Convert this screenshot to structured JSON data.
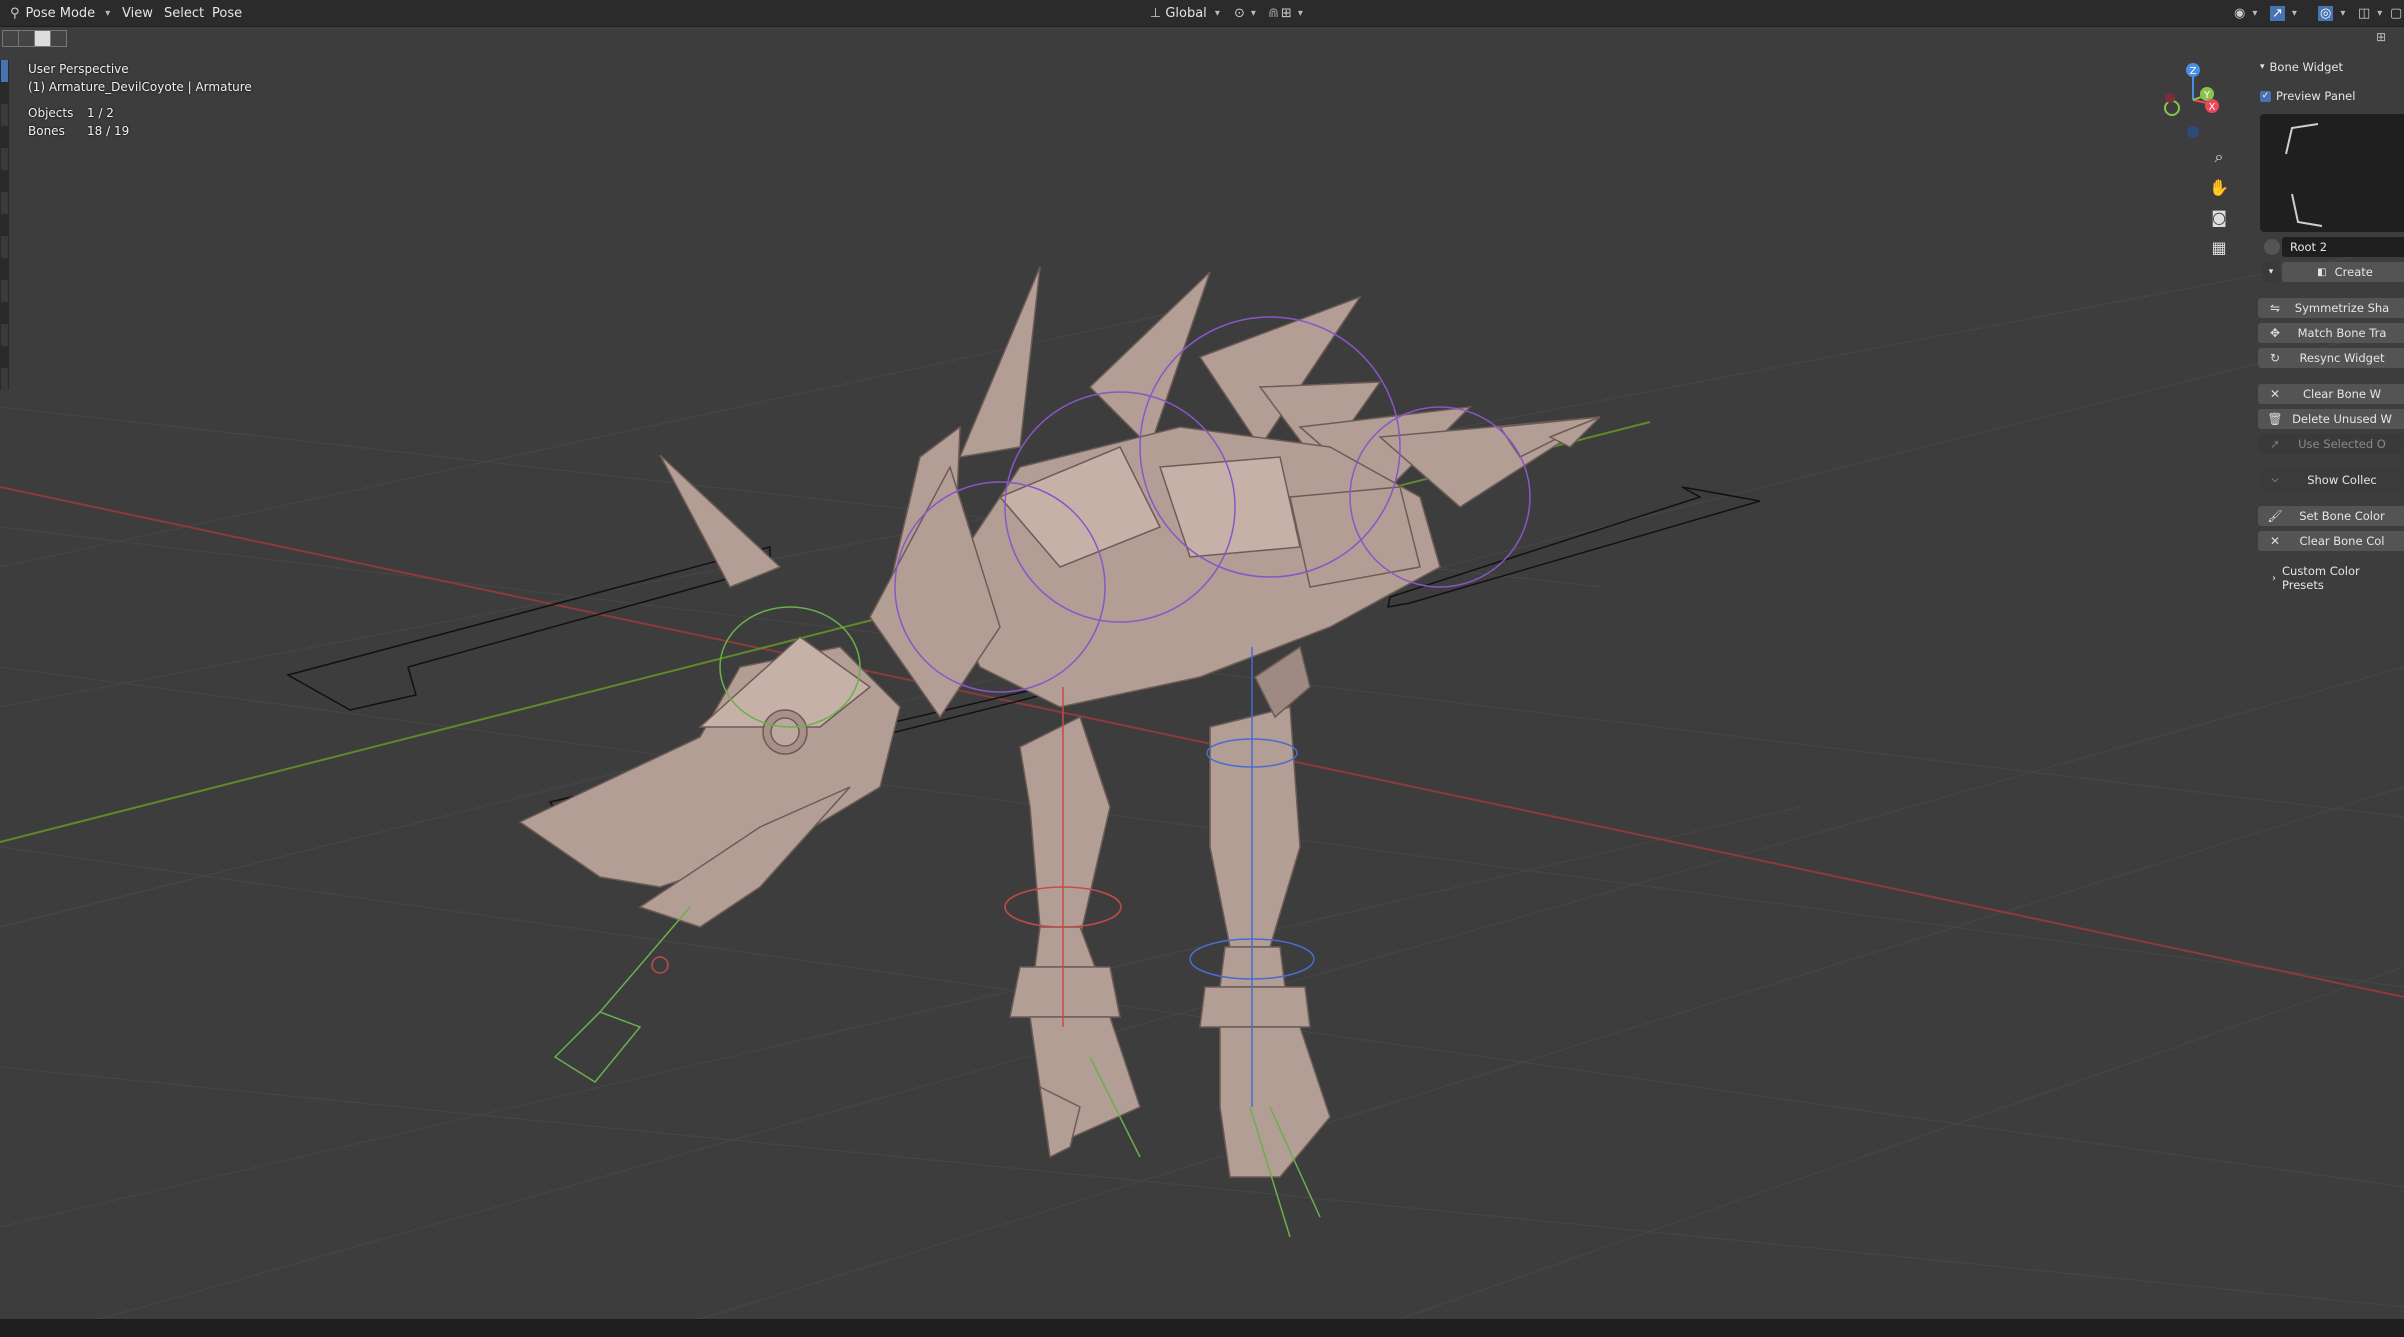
{
  "header": {
    "mode": "Pose Mode",
    "menus": [
      "View",
      "Select",
      "Pose"
    ],
    "transform_orientation": "Global"
  },
  "overlay": {
    "perspective": "User Perspective",
    "object_info": "(1) Armature_DevilCoyote | Armature",
    "stats": [
      {
        "label": "Objects",
        "value": "1 / 2"
      },
      {
        "label": "Bones",
        "value": "18 / 19"
      }
    ]
  },
  "gizmo": {
    "axes": [
      "Z",
      "Y",
      "X"
    ],
    "colors": {
      "x": "#e8485a",
      "y": "#8bc34a",
      "z": "#4a90e2"
    }
  },
  "navigation": [
    "zoom-icon",
    "hand-icon",
    "camera-icon",
    "grid-icon"
  ],
  "npanel": {
    "title": "Bone Widget",
    "preview_label": "Preview Panel",
    "widget_name": "Root 2",
    "create_label": "Create",
    "buttons": [
      {
        "label": "Symmetrize Sha",
        "icon": "symmetrize-icon"
      },
      {
        "label": "Match Bone Tra",
        "icon": "match-icon"
      },
      {
        "label": "Resync Widget",
        "icon": "resync-icon"
      },
      {
        "label": "Clear Bone W",
        "icon": "clear-icon"
      },
      {
        "label": "Delete Unused W",
        "icon": "trash-icon"
      },
      {
        "label": "Use Selected O",
        "icon": "select-icon"
      },
      {
        "label": "Show Collec",
        "icon": "chevron-icon"
      },
      {
        "label": "Set Bone Color",
        "icon": "color-icon"
      },
      {
        "label": "Clear Bone Col",
        "icon": "clear-icon"
      }
    ],
    "presets_label": "Custom Color Presets"
  },
  "colors": {
    "viewport_bg": "#3d3d3d",
    "accent": "#4772b3",
    "model": "#b8a39a",
    "x_axis": "#a03a3a",
    "y_axis": "#5e8a2a"
  }
}
